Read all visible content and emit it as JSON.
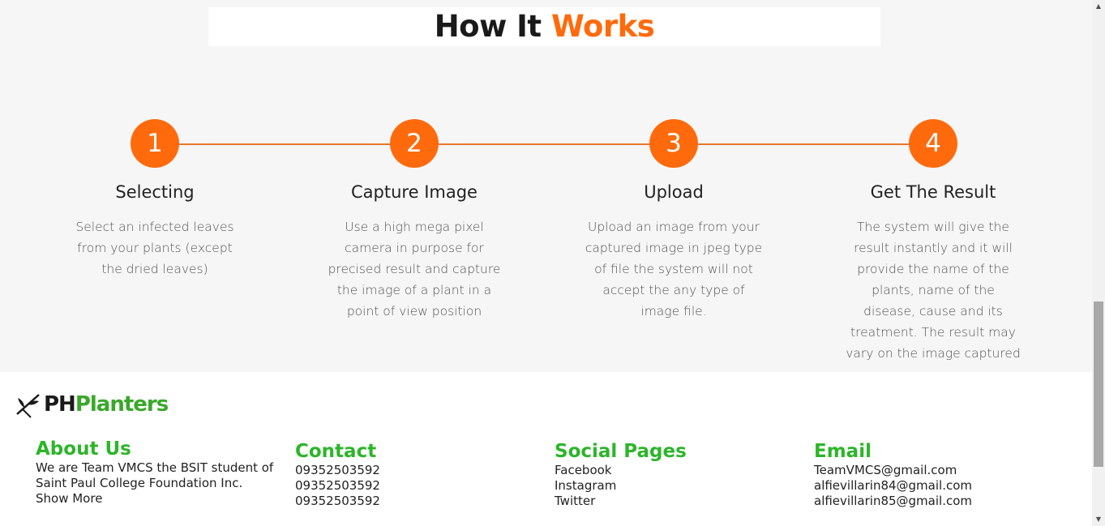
{
  "how_it_works": {
    "title_part1": "How It",
    "title_part2": "Works",
    "steps": [
      {
        "number": "1",
        "title": "Selecting",
        "desc": "Select an infected leaves from your plants (except the dried leaves)"
      },
      {
        "number": "2",
        "title": "Capture Image",
        "desc": "Use a high mega pixel camera in purpose for precised result and capture the image of a plant in a point of view position"
      },
      {
        "number": "3",
        "title": "Upload",
        "desc": "Upload an image from your captured image in jpeg type of file the system will not accept the any type of image file."
      },
      {
        "number": "4",
        "title": "Get The Result",
        "desc": "The system will give the result instantly and it will provide the name of the plants, name of the disease, cause and its treatment. The result may vary on the image captured"
      }
    ]
  },
  "footer": {
    "logo_part1": "PH",
    "logo_part2": "Planters",
    "about": {
      "heading": "About Us",
      "text": "We are Team VMCS the BSIT student of Saint Paul College Foundation Inc.",
      "more": "Show More"
    },
    "contact": {
      "heading": "Contact",
      "items": [
        "09352503592",
        "09352503592",
        "09352503592"
      ]
    },
    "social": {
      "heading": "Social Pages",
      "items": [
        "Facebook",
        "Instagram",
        "Twitter"
      ]
    },
    "email": {
      "heading": "Email",
      "items": [
        "TeamVMCS@gmail.com",
        "alfievillarin84@gmail.com",
        "alfievillarin85@gmail.com"
      ]
    }
  },
  "colors": {
    "accent_orange": "#ff6a0d",
    "accent_green": "#2db52a"
  },
  "icons": {
    "logo_mark": "plant-icon",
    "scroll_up": "triangle-up-icon",
    "scroll_down": "triangle-down-icon"
  }
}
